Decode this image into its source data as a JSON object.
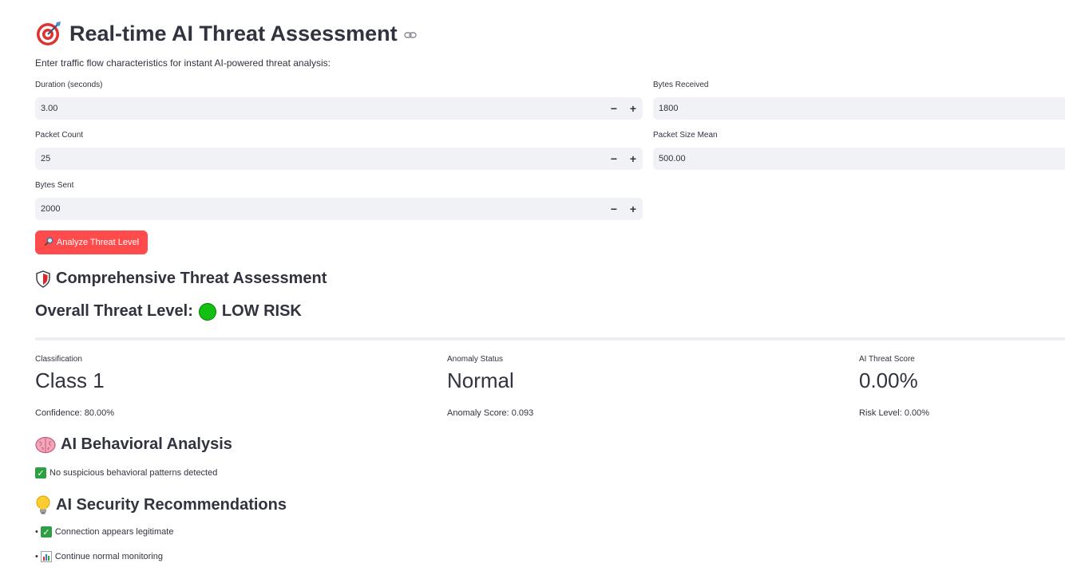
{
  "header": {
    "title": "Real-time AI Threat Assessment",
    "subtitle": "Enter traffic flow characteristics for instant AI-powered threat analysis:"
  },
  "inputs": {
    "duration": {
      "label": "Duration (seconds)",
      "value": "3.00"
    },
    "packet_count": {
      "label": "Packet Count",
      "value": "25"
    },
    "bytes_sent": {
      "label": "Bytes Sent",
      "value": "2000"
    },
    "bytes_received": {
      "label": "Bytes Received",
      "value": "1800"
    },
    "packet_size_mean": {
      "label": "Packet Size Mean",
      "value": "500.00"
    },
    "minus_label": "−",
    "plus_label": "+"
  },
  "analyze_button": {
    "label": "Analyze Threat Level",
    "icon": "magnifier-icon"
  },
  "assessment": {
    "heading": "Comprehensive Threat Assessment",
    "overall_prefix": "Overall Threat Level:",
    "overall_value": "LOW RISK",
    "status_color": "#11c011"
  },
  "metrics": [
    {
      "label": "Classification",
      "value": "Class 1",
      "caption": "Confidence: 80.00%"
    },
    {
      "label": "Anomaly Status",
      "value": "Normal",
      "caption": "Anomaly Score: 0.093"
    },
    {
      "label": "AI Threat Score",
      "value": "0.00%",
      "caption": "Risk Level: 0.00%"
    }
  ],
  "behavioral": {
    "heading": "AI Behavioral Analysis",
    "result": "No suspicious behavioral patterns detected"
  },
  "recommendations": {
    "heading": "AI Security Recommendations",
    "items": [
      "Connection appears legitimate",
      "Continue normal monitoring"
    ]
  },
  "colors": {
    "accent": "#ff4b4b",
    "input_bg": "#f0f2f6",
    "text": "#31333f",
    "check": "#2ea043"
  }
}
